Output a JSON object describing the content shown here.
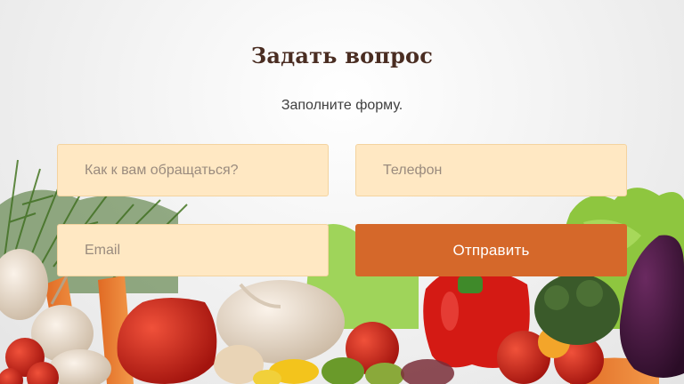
{
  "form": {
    "title": "Задать вопрос",
    "subtitle": "Заполните форму.",
    "name_placeholder": "Как к вам обращаться?",
    "phone_placeholder": "Телефон",
    "email_placeholder": "Email",
    "submit_label": "Отправить"
  },
  "colors": {
    "title": "#4a2d22",
    "input_background": "#ffe8c3",
    "submit_background": "#d5682a",
    "submit_text": "#ffffff"
  }
}
